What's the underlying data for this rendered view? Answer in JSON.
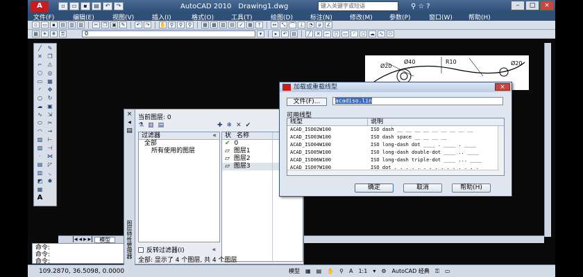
{
  "window": {
    "app_title": "AutoCAD 2010",
    "document_title": "Drawing1.dwg",
    "search_placeholder": "键入关键字或短语",
    "minimize": "–",
    "maximize": "□",
    "close": "×"
  },
  "menubar": {
    "items": [
      "文件(F)",
      "编辑(E)",
      "视图(V)",
      "插入(I)",
      "格式(O)",
      "工具(T)",
      "绘图(D)",
      "标注(N)",
      "修改(M)",
      "参数(P)",
      "窗口(W)",
      "帮助(H)"
    ]
  },
  "layer_toolbar": {
    "current_layer_value": "0"
  },
  "layer_palette": {
    "close_label": "×",
    "vertical_title": "图层特性管理器",
    "current_layer_label": "当前图层: 0",
    "filters_header": "过滤器",
    "tree_all": "全部",
    "tree_used": "所有使用的图层",
    "columns": {
      "status": "状",
      "name": "名称"
    },
    "layers": [
      "0",
      "图层1",
      "图层2",
      "图层3"
    ],
    "invert_filter_label": "反转过滤器(I)",
    "summary": "全部: 显示了 4 个图层, 共 4 个图层"
  },
  "linetype_dialog": {
    "title": "加载或重载线型",
    "file_button": "文件(F)...",
    "file_value": "acadiso.lin",
    "available_label": "可用线型",
    "columns": {
      "linetype": "线型",
      "description": "说明"
    },
    "rows": [
      {
        "name": "ACAD_ISO02W100",
        "desc": "ISO dash __ __ __ __ __ __ __ __ __"
      },
      {
        "name": "ACAD_ISO03W100",
        "desc": "ISO dash space __    __    __    __"
      },
      {
        "name": "ACAD_ISO04W100",
        "desc": "ISO long-dash dot ____ . ____ . ____"
      },
      {
        "name": "ACAD_ISO05W100",
        "desc": "ISO long-dash double-dot ____ .. ____"
      },
      {
        "name": "ACAD_ISO06W100",
        "desc": "ISO long-dash triple-dot ____ ... ____"
      },
      {
        "name": "ACAD_ISO07W100",
        "desc": "ISO dot . . . . . . . . . . . . . . ."
      }
    ],
    "ok_button": "确定",
    "cancel_button": "取消",
    "help_button": "帮助(H)"
  },
  "canvas": {
    "model_tab": "模型",
    "dim_labels": [
      "Ø20",
      "Ø40",
      "R10",
      "Ø20"
    ]
  },
  "command_line": {
    "lines": [
      "命令:",
      "命令:",
      "命令:"
    ]
  },
  "status_bar": {
    "coordinates": "109.2870, 36.5098, 0.0000",
    "model_label": "模型",
    "scale_label": "1:1",
    "workspace_label": "AutoCAD 经典"
  }
}
